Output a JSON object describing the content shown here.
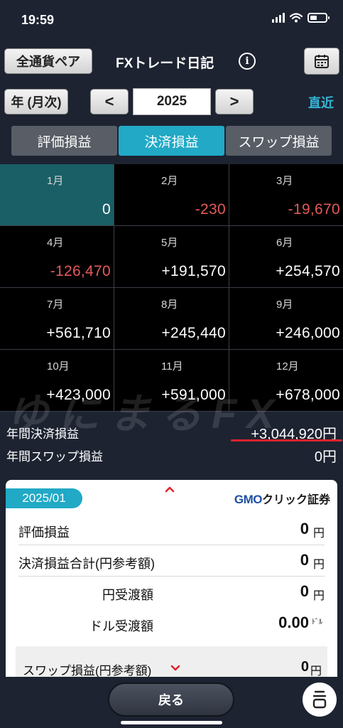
{
  "status_bar": {
    "time": "19:59"
  },
  "header": {
    "left_button": "全通貨ペア",
    "title": "FXトレード日記",
    "info_icon": "i",
    "calendar_icon": "calendar-icon"
  },
  "period": {
    "mode_button": "年 (月次)",
    "prev": "<",
    "year": "2025",
    "next": ">",
    "recent_link": "直近"
  },
  "tabs": [
    {
      "label": "評価損益",
      "active": false
    },
    {
      "label": "決済損益",
      "active": true
    },
    {
      "label": "スワップ損益",
      "active": false
    }
  ],
  "months": [
    {
      "label": "1月",
      "value": "0",
      "sign": "zero"
    },
    {
      "label": "2月",
      "value": "-230",
      "sign": "neg"
    },
    {
      "label": "3月",
      "value": "-19,670",
      "sign": "neg"
    },
    {
      "label": "4月",
      "value": "-126,470",
      "sign": "neg"
    },
    {
      "label": "5月",
      "value": "+191,570",
      "sign": "pos"
    },
    {
      "label": "6月",
      "value": "+254,570",
      "sign": "pos"
    },
    {
      "label": "7月",
      "value": "+561,710",
      "sign": "pos"
    },
    {
      "label": "8月",
      "value": "+245,440",
      "sign": "pos"
    },
    {
      "label": "9月",
      "value": "+246,000",
      "sign": "pos"
    },
    {
      "label": "10月",
      "value": "+423,000",
      "sign": "pos"
    },
    {
      "label": "11月",
      "value": "+591,000",
      "sign": "pos"
    },
    {
      "label": "12月",
      "value": "+678,000",
      "sign": "pos"
    }
  ],
  "watermark": "ゆにまるFX",
  "summary": {
    "annual_settlement_label": "年間決済損益",
    "annual_settlement_value": "+3,044,920円",
    "annual_swap_label": "年間スワップ損益",
    "annual_swap_value": "0円"
  },
  "detail": {
    "badge": "2025/01",
    "logo_gmo": "GMO",
    "logo_rest": "クリック証券",
    "rows": [
      {
        "label": "評価損益",
        "value": "0",
        "unit": "円"
      },
      {
        "label": "決済損益合計(円参考額)",
        "value": "0",
        "unit": "円"
      },
      {
        "label": "円受渡額",
        "value": "0",
        "unit": "円"
      },
      {
        "label": "ドル受渡額",
        "value": "0.00",
        "unit": "ﾄﾞﾙ"
      }
    ],
    "swap_label": "スワップ損益(円参考額)",
    "swap_value": "0",
    "swap_unit": "円"
  },
  "bottom": {
    "back_label": "戻る"
  },
  "colors": {
    "accent": "#21a9c6",
    "negative": "#e35a5a",
    "background": "#1d2331",
    "underline": "#e0232d"
  }
}
